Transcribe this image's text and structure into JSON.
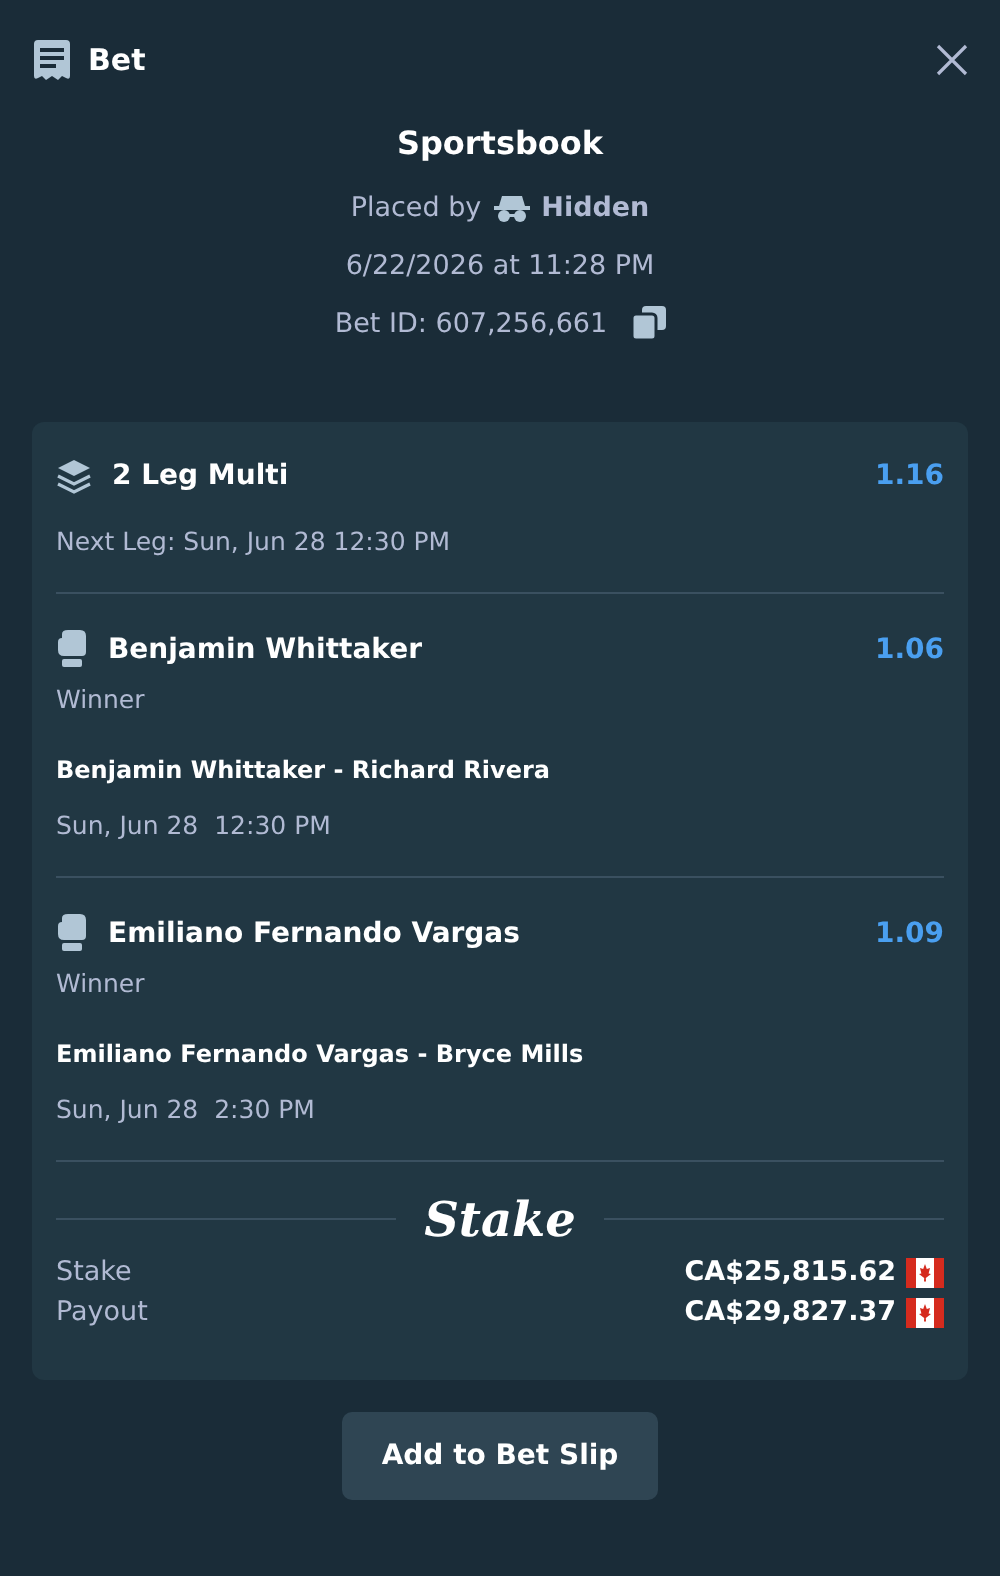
{
  "header": {
    "title": "Bet"
  },
  "summary": {
    "title": "Sportsbook",
    "placed_by_label": "Placed by",
    "placed_by_user": "Hidden",
    "date": "6/22/2026 at 11:28 PM",
    "bet_id": "Bet ID: 607,256,661"
  },
  "bet": {
    "type": "2 Leg Multi",
    "odds": "1.16",
    "next_leg": "Next Leg: Sun, Jun 28 12:30 PM"
  },
  "legs": [
    {
      "name": "Benjamin Whittaker",
      "odds": "1.06",
      "market": "Winner",
      "event": "Benjamin Whittaker - Richard Rivera",
      "time": "Sun, Jun 28  12:30 PM"
    },
    {
      "name": "Emiliano Fernando Vargas",
      "odds": "1.09",
      "market": "Winner",
      "event": "Emiliano Fernando Vargas - Bryce Mills",
      "time": "Sun, Jun 28  2:30 PM"
    }
  ],
  "logo": "Stake",
  "totals": [
    {
      "label": "Stake",
      "amount": "CA$25,815.62"
    },
    {
      "label": "Payout",
      "amount": "CA$29,827.37"
    }
  ],
  "action": "Add to Bet Slip"
}
